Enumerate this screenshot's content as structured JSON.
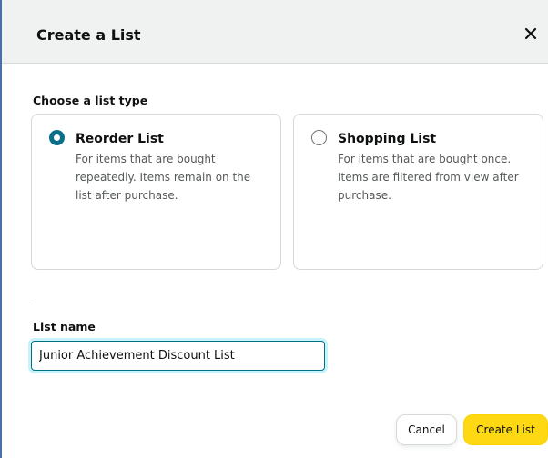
{
  "dialog": {
    "title": "Create a List"
  },
  "list_type": {
    "label": "Choose a list type",
    "options": [
      {
        "title": "Reorder List",
        "description": "For items that are bought repeatedly. Items remain on the list after purchase.",
        "selected": true
      },
      {
        "title": "Shopping List",
        "description": "For items that are bought once. Items are filtered from view after purchase.",
        "selected": false
      }
    ]
  },
  "list_name": {
    "label": "List name",
    "value": "Junior Achievement Discount List"
  },
  "buttons": {
    "cancel": "Cancel",
    "create": "Create List"
  },
  "colors": {
    "accent": "#0b6f8a",
    "primary_button": "#ffd814",
    "focus_ring": "#c8f3fa"
  }
}
